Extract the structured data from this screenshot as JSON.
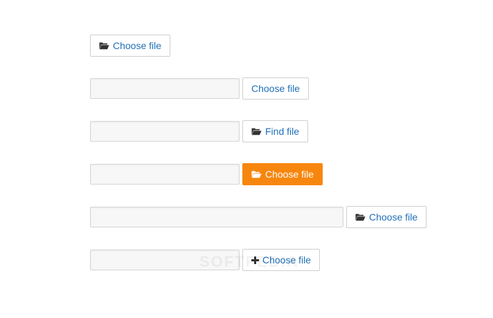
{
  "rows": [
    {
      "button": {
        "label": "Choose file",
        "icon": "folder-open-icon"
      }
    },
    {
      "input_value": "",
      "button": {
        "label": "Choose file"
      }
    },
    {
      "input_value": "",
      "button": {
        "label": "Find file",
        "icon": "folder-open-icon"
      }
    },
    {
      "input_value": "",
      "button": {
        "label": "Choose file",
        "icon": "folder-open-icon",
        "color": "#f7860f"
      }
    },
    {
      "input_value": "",
      "button": {
        "label": "Choose file",
        "icon": "folder-open-icon"
      }
    },
    {
      "input_value": "",
      "button": {
        "label": "Choose file",
        "icon": "plus-icon"
      }
    }
  ],
  "watermark": {
    "text": "SOFTPEDIA"
  },
  "colors": {
    "link_blue": "#1e6fb8",
    "accent_orange": "#f7860f",
    "field_bg": "#f7f7f7",
    "border": "#cfcfcf"
  }
}
